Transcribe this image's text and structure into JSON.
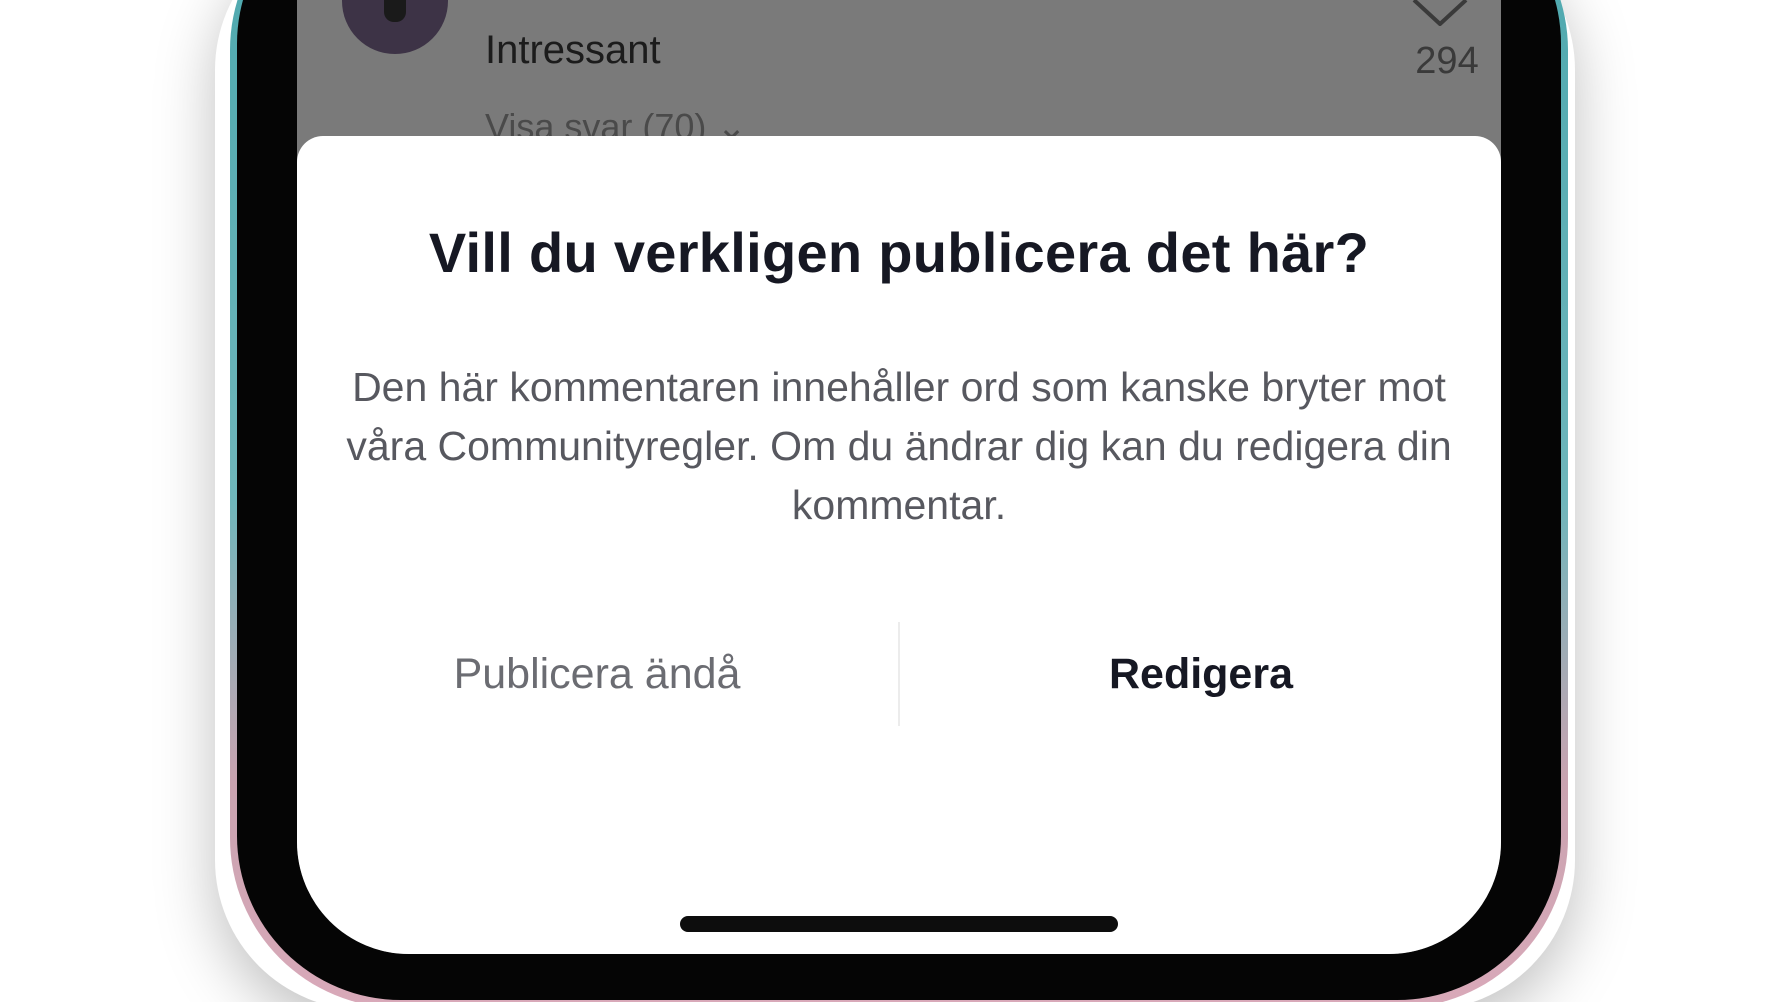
{
  "comment": {
    "text": "Intressant",
    "replies_label": "Visa svar (70)",
    "replies_chevron": "⌄",
    "like_count": "294",
    "like_icon": "heart-outline-icon"
  },
  "dialog": {
    "title": "Vill du verkligen publicera det här?",
    "body": "Den här kommentaren innehåller ord som kanske bryter mot våra Communityregler. Om du ändrar dig kan du redigera din kommentar.",
    "publish_anyway_label": "Publicera ändå",
    "edit_label": "Redigera"
  },
  "colors": {
    "title": "#161823",
    "body": "#57585f",
    "secondary_button": "#6b6c72",
    "primary_button": "#161823",
    "overlay": "#7a7a7a"
  }
}
